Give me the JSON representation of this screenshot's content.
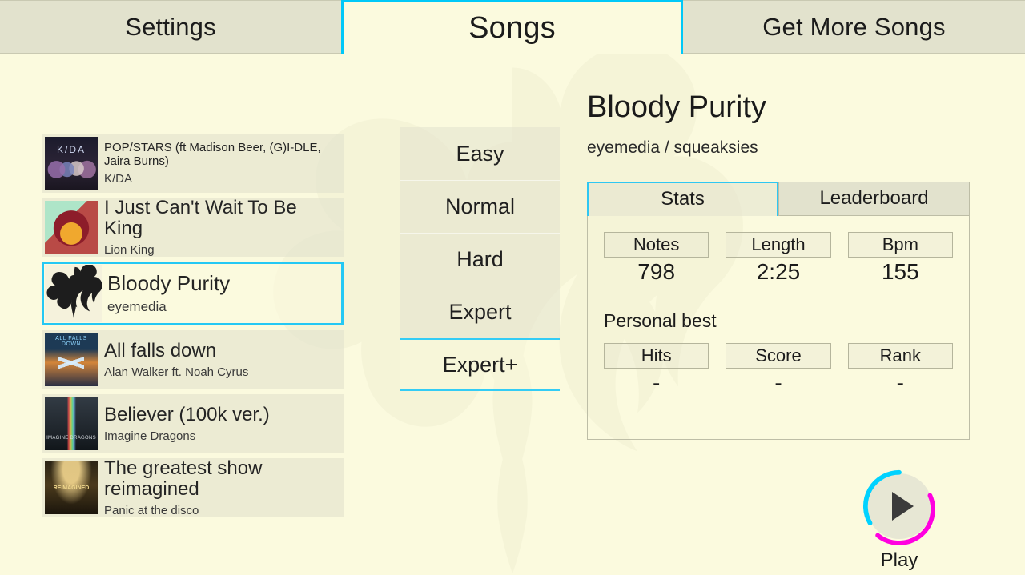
{
  "tabs": [
    {
      "label": "Settings",
      "active": false
    },
    {
      "label": "Songs",
      "active": true
    },
    {
      "label": "Get More Songs",
      "active": false
    }
  ],
  "songs": [
    {
      "title": "POP/STARS (ft Madison Beer, (G)I-DLE, Jaira Burns)",
      "artist": "K/DA",
      "art": "art-kda",
      "selected": false
    },
    {
      "title": "I Just Can't Wait To Be King",
      "artist": "Lion King",
      "art": "art-lion",
      "selected": false
    },
    {
      "title": "Bloody Purity",
      "artist": "eyemedia",
      "art": "art-bloody",
      "selected": true
    },
    {
      "title": "All falls down",
      "artist": "Alan Walker ft. Noah Cyrus",
      "art": "art-allfalls",
      "selected": false
    },
    {
      "title": "Believer (100k ver.)",
      "artist": "Imagine Dragons",
      "art": "art-believer",
      "selected": false
    },
    {
      "title": "The greatest show reimagined",
      "artist": "Panic at the disco",
      "art": "art-greatest",
      "selected": false
    }
  ],
  "difficulties": [
    {
      "label": "Easy",
      "selected": false
    },
    {
      "label": "Normal",
      "selected": false
    },
    {
      "label": "Hard",
      "selected": false
    },
    {
      "label": "Expert",
      "selected": false
    },
    {
      "label": "Expert+",
      "selected": true
    }
  ],
  "detail": {
    "title": "Bloody Purity",
    "credit": "eyemedia / squeaksies",
    "panel_tabs": [
      {
        "label": "Stats",
        "active": true
      },
      {
        "label": "Leaderboard",
        "active": false
      }
    ],
    "stats": [
      {
        "label": "Notes",
        "value": "798"
      },
      {
        "label": "Length",
        "value": "2:25"
      },
      {
        "label": "Bpm",
        "value": "155"
      }
    ],
    "personal_best_label": "Personal best",
    "personal_best": [
      {
        "label": "Hits",
        "value": "-"
      },
      {
        "label": "Score",
        "value": "-"
      },
      {
        "label": "Rank",
        "value": "-"
      }
    ]
  },
  "play": {
    "label": "Play",
    "icon": "play-triangle-icon",
    "ring_cyan": "#00d2ff",
    "ring_magenta": "#ff00e0"
  },
  "colors": {
    "page_background": "#fbfade",
    "tab_inactive": "#e2e2cd",
    "accent_cyan": "#00c8f8",
    "accent_magenta": "#ff00e0",
    "text_primary": "#1a1a1a"
  }
}
